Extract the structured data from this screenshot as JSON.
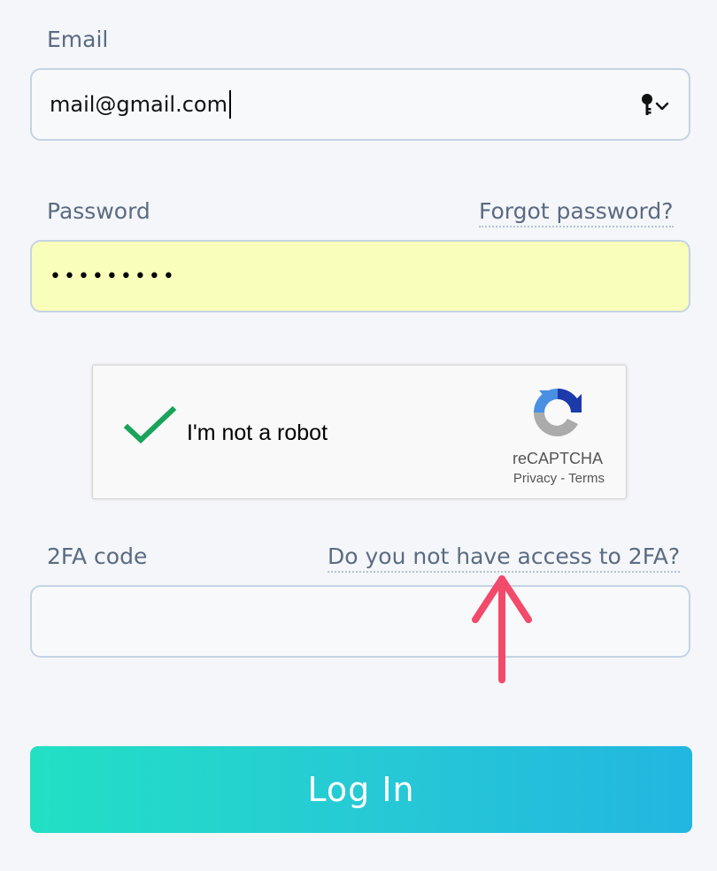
{
  "email": {
    "label": "Email",
    "value": "mail@gmail.com"
  },
  "password": {
    "label": "Password",
    "forgot_link": "Forgot password?",
    "masked_value": "•••••••••"
  },
  "captcha": {
    "text": "I'm not a robot",
    "brand": "reCAPTCHA",
    "privacy": "Privacy",
    "separator": " - ",
    "terms": "Terms",
    "checked": true
  },
  "twofa": {
    "label": "2FA code",
    "no_access_link": "Do you not have access to 2FA?",
    "value": ""
  },
  "login_button": "Log In",
  "colors": {
    "accent_start": "#22e0c4",
    "accent_end": "#22b6e0",
    "autofill_bg": "#fafebb",
    "annotation_arrow": "#f24a6b",
    "check_green": "#1aa35a"
  },
  "icons": {
    "email_field": [
      "key-icon",
      "chevron-down-icon"
    ],
    "captcha": [
      "checkmark-icon",
      "recaptcha-logo-icon"
    ],
    "annotation": "arrow-up-icon"
  }
}
